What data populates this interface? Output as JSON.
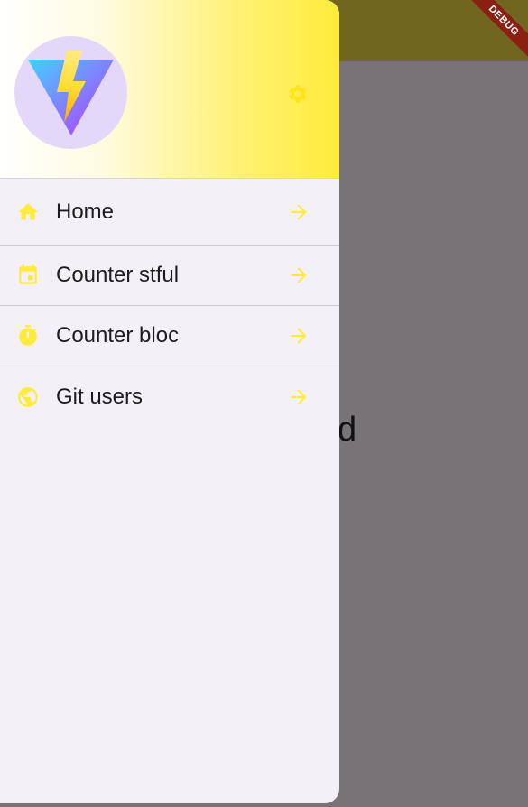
{
  "colors": {
    "accent": "#ffeb3b",
    "drawer_bg": "#f4f0f8",
    "scrim_bg": "#777377",
    "app_bar": "#706620",
    "ribbon": "#8a1f12"
  },
  "debug_banner": "DEBUG",
  "background": {
    "partial_text": "d"
  },
  "drawer": {
    "header": {
      "avatar_icon": "lightning-v-logo-icon",
      "action_icon": "settings-icon"
    },
    "items": [
      {
        "label": "Home",
        "icon": "home-icon",
        "trailing_icon": "arrow-right-icon"
      },
      {
        "label": "Counter stful",
        "icon": "calendar-icon",
        "trailing_icon": "arrow-right-icon"
      },
      {
        "label": "Counter bloc",
        "icon": "timer-icon",
        "trailing_icon": "arrow-right-icon"
      },
      {
        "label": "Git users",
        "icon": "smiley-face-icon",
        "trailing_icon": "arrow-right-icon"
      }
    ]
  }
}
